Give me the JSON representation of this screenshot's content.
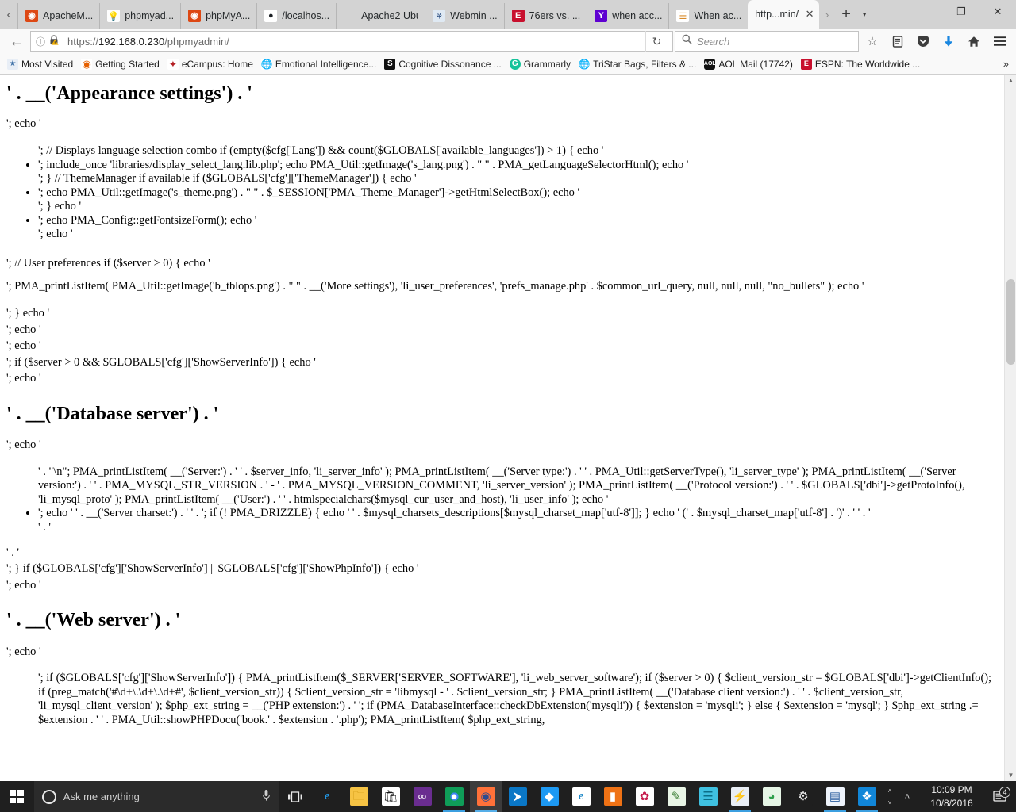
{
  "browser": {
    "tabs": [
      {
        "title": "ApacheM...",
        "favicon": "ubuntu-circle-icon",
        "active": false
      },
      {
        "title": "phpmyad...",
        "favicon": "lightbulb-icon",
        "active": false
      },
      {
        "title": "phpMyA...",
        "favicon": "ubuntu-circle-icon",
        "active": false
      },
      {
        "title": "/localhos...",
        "favicon": "github-icon",
        "active": false
      },
      {
        "title": "Apache2 Ubu...",
        "favicon": "blank-page-icon",
        "active": false
      },
      {
        "title": "Webmin ...",
        "favicon": "webmin-icon",
        "active": false
      },
      {
        "title": "76ers vs. ...",
        "favicon": "espn-icon",
        "active": false
      },
      {
        "title": "when acc...",
        "favicon": "yahoo-icon",
        "active": false
      },
      {
        "title": "When ac...",
        "favicon": "stackoverflow-icon",
        "active": false
      },
      {
        "title": "http...min/",
        "favicon": "none",
        "active": true
      }
    ],
    "tab_close_label": "✕",
    "tab_list_chevron": "›",
    "new_tab_label": "+",
    "new_tab_menu_label": "▾",
    "window_controls": {
      "minimize": "—",
      "maximize": "❐",
      "close": "✕"
    },
    "nav": {
      "back_label": "←",
      "identity_icon": "info-circle-icon",
      "lock_icon": "lock-warning-icon",
      "url_scheme": "https://",
      "url_host": "192.168.0.230",
      "url_path": "/phpmyadmin/",
      "reload_label": "↻",
      "search_placeholder": "Search",
      "search_icon": "magnifier-icon",
      "bookmark_star": "☆",
      "reader_icon": "reader-view-icon",
      "pocket_icon": "pocket-icon",
      "downloads_icon": "download-arrow-icon",
      "home_icon": "home-icon",
      "menu_icon": "hamburger-menu-icon"
    },
    "bookmarks": [
      {
        "label": "Most Visited",
        "icon": "most-visited-icon"
      },
      {
        "label": "Getting Started",
        "icon": "firefox-icon"
      },
      {
        "label": "eCampus: Home",
        "icon": "ecampus-icon"
      },
      {
        "label": "Emotional Intelligence...",
        "icon": "globe-icon"
      },
      {
        "label": "Cognitive Dissonance ...",
        "icon": "s-square-icon"
      },
      {
        "label": "Grammarly",
        "icon": "grammarly-icon"
      },
      {
        "label": "TriStar Bags, Filters & ...",
        "icon": "globe-icon"
      },
      {
        "label": "AOL Mail (17742)",
        "icon": "aol-icon"
      },
      {
        "label": "ESPN: The Worldwide ...",
        "icon": "espn-icon"
      }
    ],
    "bookmarks_overflow": "»"
  },
  "page": {
    "heading_appearance": "' . __('Appearance settings') . '",
    "line_echo_1": "'; echo '",
    "list1": [
      "'; // Displays language selection combo if (empty($cfg['Lang']) && count($GLOBALS['available_languages']) > 1) { echo '",
      "'; include_once 'libraries/display_select_lang.lib.php'; echo PMA_Util::getImage('s_lang.png') . \" \" . PMA_getLanguageSelectorHtml(); echo '",
      "'; } // ThemeManager if available if ($GLOBALS['cfg']['ThemeManager']) { echo '",
      "'; echo PMA_Util::getImage('s_theme.png') . \" \" . $_SESSION['PMA_Theme_Manager']->getHtmlSelectBox(); echo '",
      "'; } echo '",
      "'; echo PMA_Config::getFontsizeForm(); echo '",
      "'; echo '"
    ],
    "line_user_prefs": "'; // User preferences if ($server > 0) { echo '",
    "line_printlistitem": "'; PMA_printListItem( PMA_Util::getImage('b_tblops.png') . \" \" . __('More settings'), 'li_user_preferences', 'prefs_manage.php' . $common_url_query, null, null, null, \"no_bullets\" ); echo '",
    "block2": [
      "'; } echo '",
      "'; echo '",
      "'; echo '",
      "'; if ($server > 0 && $GLOBALS['cfg']['ShowServerInfo']) { echo '",
      "'; echo '"
    ],
    "heading_database_server": "' . __('Database server') . '",
    "line_echo_2": "'; echo '",
    "db_block": [
      "' . \"\\n\"; PMA_printListItem( __('Server:') . ' ' . $server_info, 'li_server_info' ); PMA_printListItem( __('Server type:') . ' ' . PMA_Util::getServerType(), 'li_server_type' ); PMA_printListItem( __('Server version:') . ' ' . PMA_MYSQL_STR_VERSION . ' - ' . PMA_MYSQL_VERSION_COMMENT, 'li_server_version' ); PMA_printListItem( __('Protocol version:') . ' ' . $GLOBALS['dbi']->getProtoInfo(), 'li_mysql_proto' ); PMA_printListItem( __('User:') . ' ' . htmlspecialchars($mysql_cur_user_and_host), 'li_user_info' ); echo '",
      "'; echo ' ' . __('Server charset:') . ' ' . '; if (! PMA_DRIZZLE) { echo ' ' . $mysql_charsets_descriptions[$mysql_charset_map['utf-8']]; } echo ' (' . $mysql_charset_map['utf-8'] . ')' . ' ' . '",
      "' . '"
    ],
    "block3": [
      "' . '",
      "'; } if ($GLOBALS['cfg']['ShowServerInfo'] || $GLOBALS['cfg']['ShowPhpInfo']) { echo '",
      "'; echo '"
    ],
    "heading_web_server": "' . __('Web server') . '",
    "line_echo_3": "'; echo '",
    "web_block": [
      "'; if ($GLOBALS['cfg']['ShowServerInfo']) { PMA_printListItem($_SERVER['SERVER_SOFTWARE'], 'li_web_server_software'); if ($server > 0) { $client_version_str = $GLOBALS['dbi']->getClientInfo(); if (preg_match('#\\d+\\.\\d+\\.\\d+#', $client_version_str)) { $client_version_str = 'libmysql - ' . $client_version_str; } PMA_printListItem( __('Database client version:') . ' ' . $client_version_str, 'li_mysql_client_version' ); $php_ext_string = __('PHP extension:') . ' '; if (PMA_DatabaseInterface::checkDbExtension('mysqli')) { $extension = 'mysqli'; } else { $extension = 'mysql'; } $php_ext_string .= $extension . ' ' . PMA_Util::showPHPDocu('book.' . $extension . '.php'); PMA_printListItem( $php_ext_string,"
    ],
    "scroll_up_arrow": "▲",
    "scroll_down_arrow": "▼"
  },
  "taskbar": {
    "start_label": "start-button",
    "cortana_placeholder": "Ask me anything",
    "mic_icon": "microphone-icon",
    "task_view_icon": "task-view-icon",
    "apps": [
      {
        "name": "microsoft-edge",
        "glyph": "e",
        "cls": "g-edge",
        "running": false,
        "active": false
      },
      {
        "name": "file-explorer",
        "glyph": "🗀",
        "cls": "g-folder",
        "running": false,
        "active": false
      },
      {
        "name": "microsoft-store",
        "glyph": "🛍",
        "cls": "g-store",
        "running": false,
        "active": false
      },
      {
        "name": "visual-studio",
        "glyph": "∞",
        "cls": "g-vs",
        "running": false,
        "active": false
      },
      {
        "name": "google-chrome",
        "glyph": "●",
        "cls": "g-chrome",
        "running": true,
        "active": true
      },
      {
        "name": "mozilla-firefox",
        "glyph": "◉",
        "cls": "g-firefox",
        "running": true,
        "active": false
      },
      {
        "name": "visual-studio-code",
        "glyph": "⮞",
        "cls": "g-vscode",
        "running": false,
        "active": false
      },
      {
        "name": "kate-editor",
        "glyph": "◆",
        "cls": "g-kate",
        "running": false,
        "active": false
      },
      {
        "name": "internet-explorer",
        "glyph": "e",
        "cls": "g-ie",
        "running": false,
        "active": false
      },
      {
        "name": "orange-app",
        "glyph": "▮",
        "cls": "g-orange",
        "running": false,
        "active": false
      },
      {
        "name": "raspberry-pi",
        "glyph": "✿",
        "cls": "g-rpi",
        "running": false,
        "active": false
      },
      {
        "name": "notepad-editor",
        "glyph": "✎",
        "cls": "g-notepad",
        "running": false,
        "active": false
      },
      {
        "name": "server-manager",
        "glyph": "☰",
        "cls": "g-server",
        "running": false,
        "active": false
      },
      {
        "name": "network-share",
        "glyph": "⚡",
        "cls": "g-netshare",
        "running": true,
        "active": false
      },
      {
        "name": "wifi-manager",
        "glyph": "◕",
        "cls": "g-wifi",
        "running": false,
        "active": false
      },
      {
        "name": "settings",
        "glyph": "⚙",
        "cls": "g-gear",
        "running": false,
        "active": false
      },
      {
        "name": "remote-desktop",
        "glyph": "▤",
        "cls": "g-idcard",
        "running": true,
        "active": false
      },
      {
        "name": "windows-defender",
        "glyph": "❖",
        "cls": "g-defender",
        "running": true,
        "active": false
      }
    ],
    "tray_up_arrow": "˄",
    "tray_down_arrow": "˅",
    "tray_expand": "˄",
    "clock_time": "10:09 PM",
    "clock_date": "10/8/2016",
    "action_center_icon": "notification-icon",
    "action_center_count": "4"
  }
}
